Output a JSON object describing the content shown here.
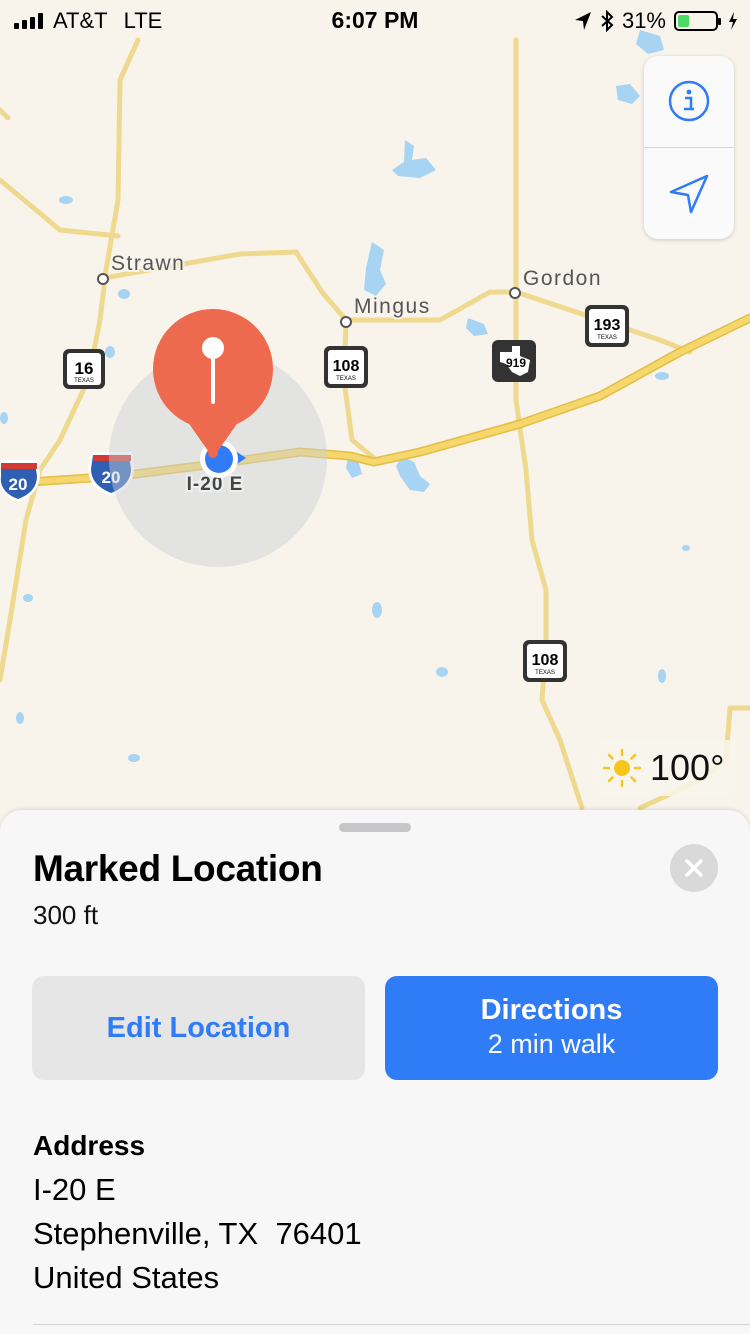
{
  "status_bar": {
    "carrier": "AT&T",
    "network": "LTE",
    "time": "6:07 PM",
    "battery_percent": "31%",
    "battery_level": 0.31,
    "icons": [
      "signal-bars-icon",
      "location-arrow-icon",
      "bluetooth-icon",
      "battery-icon",
      "charging-bolt-icon"
    ]
  },
  "map": {
    "place_labels": {
      "strawn": "Strawn",
      "mingus": "Mingus",
      "gordon": "Gordon"
    },
    "road_label": "I-20 E",
    "shields": {
      "interstate": "20",
      "tx16": "16",
      "tx108": "108",
      "tx193": "193",
      "fm919": "919",
      "state": "TEXAS"
    },
    "weather": {
      "temperature": "100°",
      "icon": "sun-icon"
    },
    "controls": {
      "info_icon": "info-icon",
      "location_icon": "location-arrow-icon"
    },
    "colors": {
      "land": "#f8f4ec",
      "water": "#a6d4f2",
      "highway": "#f6d76b",
      "road": "#f3e2a7",
      "pin": "#ee6a4f",
      "user_dot": "#2f7cf6"
    }
  },
  "sheet": {
    "title": "Marked Location",
    "distance": "300 ft",
    "edit_button": "Edit Location",
    "directions_button": {
      "label": "Directions",
      "detail": "2 min walk"
    },
    "address": {
      "heading": "Address",
      "line1": "I-20 E",
      "line2": "Stephenville, TX  76401",
      "line3": "United States"
    },
    "colors": {
      "accent": "#2f7cf6"
    }
  }
}
